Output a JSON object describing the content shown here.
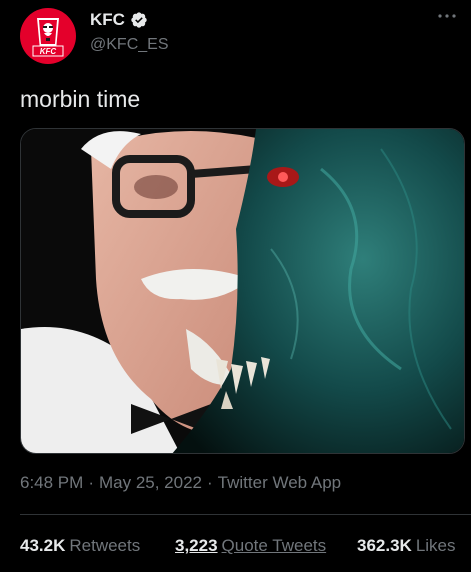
{
  "account": {
    "display_name": "KFC",
    "handle": "@KFC_ES",
    "avatar_text": "KFC",
    "verified": true
  },
  "tweet": {
    "text": "morbin time"
  },
  "meta": {
    "time": "6:48 PM",
    "date": "May 25, 2022",
    "source": "Twitter Web App",
    "separator": "·"
  },
  "stats": {
    "retweets_count": "43.2K",
    "retweets_label": "Retweets",
    "quotes_count": "3,223",
    "quotes_label": "Quote Tweets",
    "likes_count": "362.3K",
    "likes_label": "Likes"
  },
  "colors": {
    "background": "#000000",
    "text_primary": "#e7e9ea",
    "text_secondary": "#71767b",
    "kfc_red": "#e4002b",
    "divider": "#2f3336"
  },
  "icons": {
    "verified": "verified-badge-icon",
    "more": "more-horizontal-icon"
  }
}
